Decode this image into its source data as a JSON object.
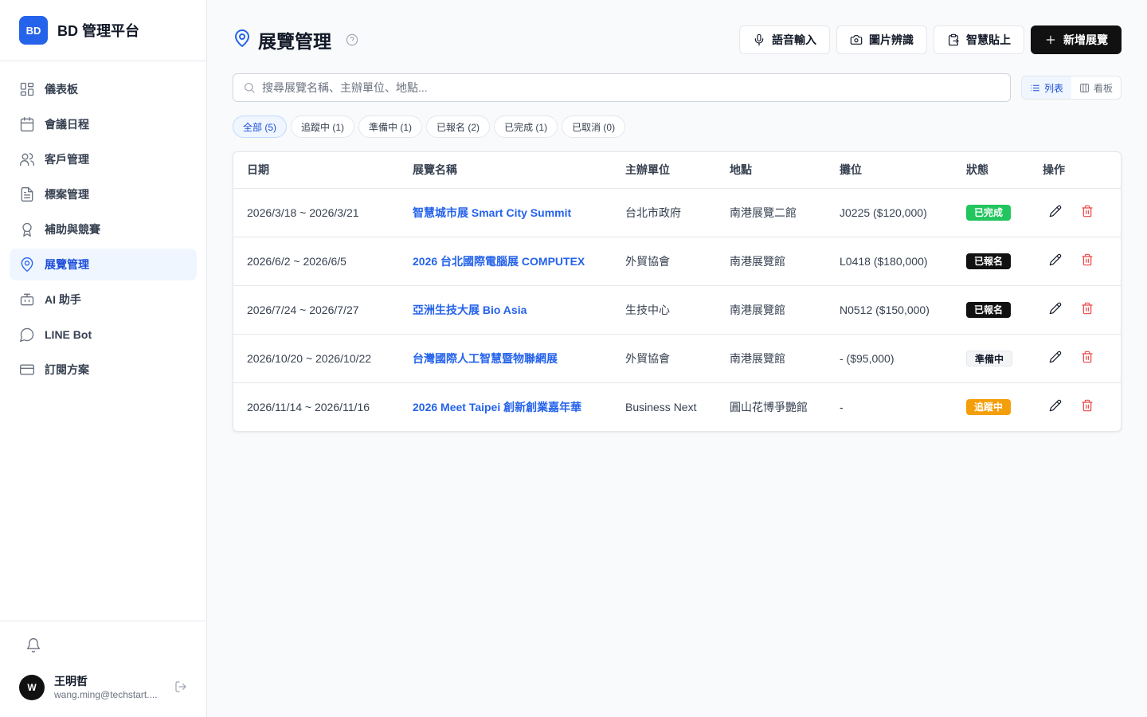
{
  "brand": {
    "logo": "BD",
    "name": "BD 管理平台",
    "color": "#2563eb"
  },
  "sidebar": {
    "items": [
      {
        "label": "儀表板",
        "icon": "dashboard-icon"
      },
      {
        "label": "會議日程",
        "icon": "calendar-icon"
      },
      {
        "label": "客戶管理",
        "icon": "users-icon"
      },
      {
        "label": "標案管理",
        "icon": "document-icon"
      },
      {
        "label": "補助與競賽",
        "icon": "award-icon"
      },
      {
        "label": "展覽管理",
        "icon": "map-pin-icon",
        "active": true
      },
      {
        "label": "AI 助手",
        "icon": "bot-icon"
      },
      {
        "label": "LINE Bot",
        "icon": "chat-icon"
      },
      {
        "label": "訂閱方案",
        "icon": "credit-card-icon"
      }
    ]
  },
  "user": {
    "initial": "W",
    "name": "王明哲",
    "email": "wang.ming@techstart...."
  },
  "page": {
    "title": "展覽管理"
  },
  "actions": {
    "voice": "語音輸入",
    "image": "圖片辨識",
    "paste": "智慧貼上",
    "add": "新增展覽"
  },
  "search": {
    "placeholder": "搜尋展覽名稱、主辦單位、地點...",
    "value": ""
  },
  "view_toggle": {
    "list": "列表",
    "board": "看板",
    "selected": "list"
  },
  "filters": [
    "全部 (5)",
    "追蹤中 (1)",
    "準備中 (1)",
    "已報名 (2)",
    "已完成 (1)",
    "已取消 (0)"
  ],
  "table": {
    "headers": [
      "日期",
      "展覽名稱",
      "主辦單位",
      "地點",
      "攤位",
      "狀態",
      "操作"
    ],
    "rows": [
      {
        "date": "2026/3/18 ~ 2026/3/21",
        "name": "智慧城市展 Smart City Summit",
        "organizer": "台北市政府",
        "location": "南港展覽二館",
        "booth": "J0225 ($120,000)",
        "status": "已完成",
        "status_bg": "#22c55e",
        "status_fg": "#ffffff"
      },
      {
        "date": "2026/6/2 ~ 2026/6/5",
        "name": "2026 台北國際電腦展 COMPUTEX",
        "organizer": "外貿協會",
        "location": "南港展覽館",
        "booth": "L0418 ($180,000)",
        "status": "已報名",
        "status_bg": "#111111",
        "status_fg": "#ffffff"
      },
      {
        "date": "2026/7/24 ~ 2026/7/27",
        "name": "亞洲生技大展 Bio Asia",
        "organizer": "生技中心",
        "location": "南港展覽館",
        "booth": "N0512 ($150,000)",
        "status": "已報名",
        "status_bg": "#111111",
        "status_fg": "#ffffff"
      },
      {
        "date": "2026/10/20 ~ 2026/10/22",
        "name": "台灣國際人工智慧暨物聯網展",
        "organizer": "外貿協會",
        "location": "南港展覽館",
        "booth": "- ($95,000)",
        "status": "準備中",
        "status_bg": "#f3f4f6",
        "status_fg": "#111827"
      },
      {
        "date": "2026/11/14 ~ 2026/11/16",
        "name": "2026 Meet Taipei 創新創業嘉年華",
        "organizer": "Business Next",
        "location": "圓山花博爭艷館",
        "booth": "-",
        "status": "追蹤中",
        "status_bg": "#f59e0b",
        "status_fg": "#ffffff"
      }
    ]
  }
}
